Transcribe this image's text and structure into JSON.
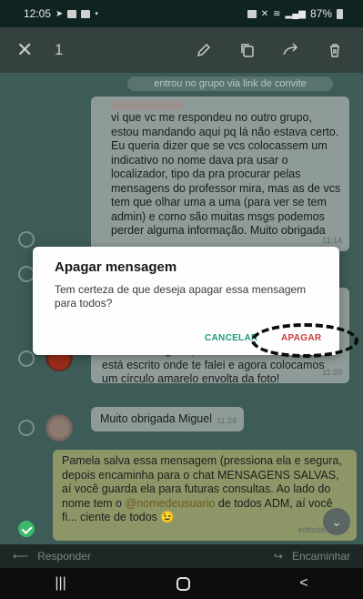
{
  "status_bar": {
    "time": "12:05",
    "battery": "87%"
  },
  "toolbar": {
    "close_glyph": "✕",
    "selected_count": "1",
    "icons": [
      "edit-icon",
      "copy-icon",
      "forward-icon",
      "delete-icon"
    ]
  },
  "chat": {
    "system_message": "entrou no grupo via link de convite",
    "messages": [
      {
        "text": "vi que vc me respondeu no outro grupo, estou mandando aqui pq lá não estava certo. Eu queria dizer que se vcs colocassem um indicativo no nome dava pra usar o localizador, tipo da pra procurar pelas mensagens do professor mira, mas as de vcs tem que olhar uma a uma (para ver se tem admin) e como são muitas msgs podemos perder alguma informação. Muito obrigada",
        "time": "11:14"
      },
      {
        "text": "coisas o telegram, não só o w... O admin já está escrito onde te falei e agora colocamos um círculo amarelo envolta da foto!",
        "time": "11:20"
      },
      {
        "text": "Muito obrigada Miguel",
        "time": "11:24"
      },
      {
        "text_before": "Pamela salva essa mensagem (pressiona ela e segura, depois encaminha para o chat MENSAGENS SALVAS, aí você guarda ela para futuras consultas. Ao lado do nome tem o ",
        "mention": "@nomedeusuario",
        "text_after": " de todos ADM, aí você fi... ciente de todos 😉",
        "time": "editada 11:3..."
      }
    ]
  },
  "bottom_bar": {
    "reply_label": "Responder",
    "forward_label": "Encaminhar"
  },
  "dialog": {
    "title": "Apagar mensagem",
    "message": "Tem certeza de que deseja apagar essa mensagem para todos?",
    "cancel_label": "CANCELAR",
    "delete_label": "APAGAR"
  },
  "colors": {
    "accent": "#1d9c7e",
    "delete": "#c93b3b",
    "selected": "#3bb86a"
  }
}
